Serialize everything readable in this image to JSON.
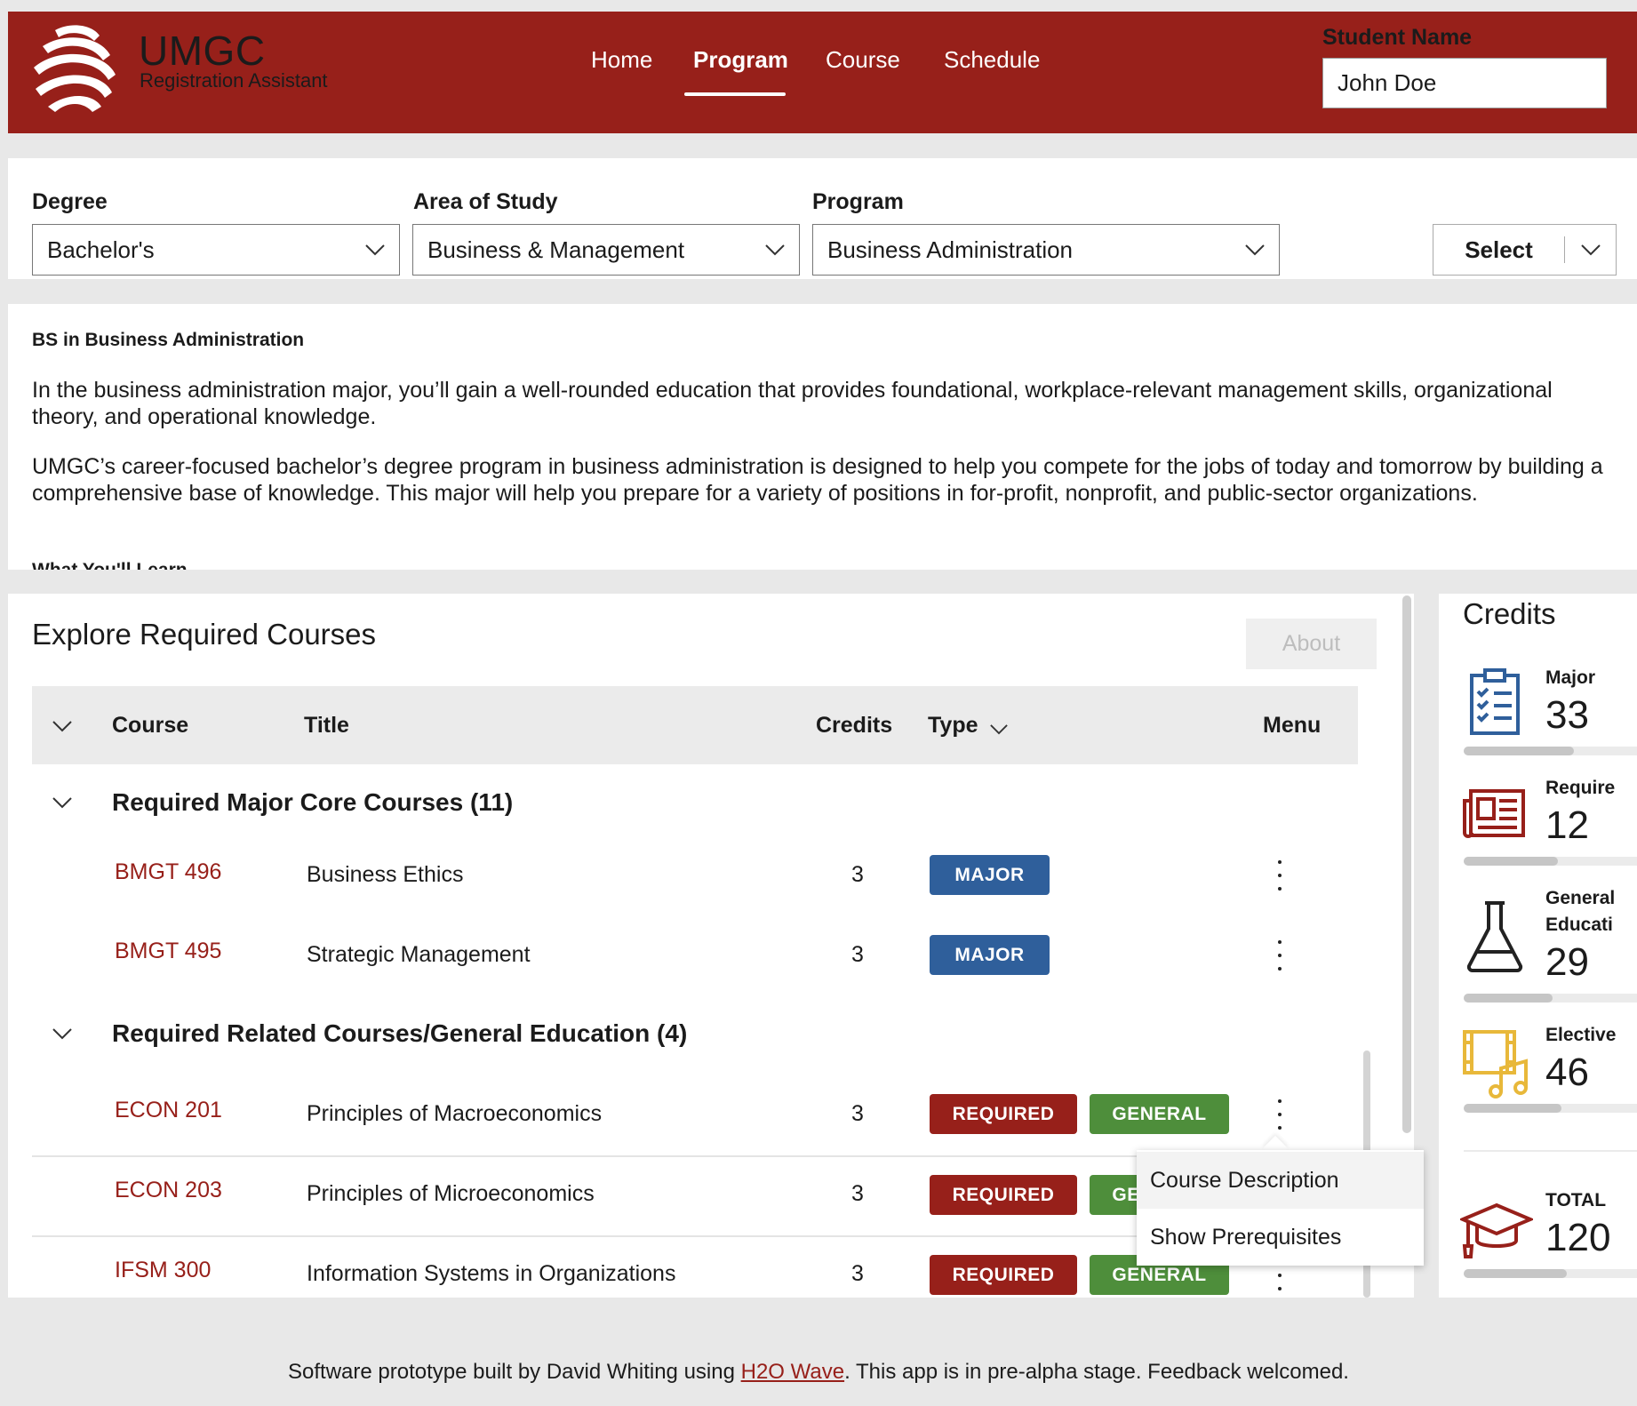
{
  "header": {
    "brand_title": "UMGC",
    "brand_subtitle": "Registration Assistant",
    "nav": [
      "Home",
      "Program",
      "Course",
      "Schedule"
    ],
    "active_nav": "Program",
    "student_label": "Student Name",
    "student_value": "John Doe",
    "color": "#97201a"
  },
  "selection": {
    "degree_label": "Degree",
    "degree_value": "Bachelor's",
    "area_label": "Area of Study",
    "area_value": "Business & Management",
    "program_label": "Program",
    "program_value": "Business Administration",
    "select_label": "Select"
  },
  "description": {
    "title": "BS in Business Administration",
    "p1": "In the business administration major, you’ll gain a well-rounded education that provides foundational, workplace-relevant management skills, organizational theory, and operational knowledge.",
    "p2": "UMGC’s career-focused bachelor’s degree program in business administration is designed to help you compete for the jobs of today and tomorrow by building a comprehensive base of knowledge. This major will help you prepare for a variety of positions in for-profit, nonprofit, and public-sector organizations.",
    "next_heading": "What You'll Learn"
  },
  "courses": {
    "title": "Explore Required Courses",
    "about_label": "About",
    "columns": {
      "course": "Course",
      "title": "Title",
      "credits": "Credits",
      "type": "Type",
      "menu": "Menu"
    },
    "groups": [
      {
        "label": "Required Major Core Courses (11)",
        "rows": [
          {
            "code": "BMGT 496",
            "title": "Business Ethics",
            "credits": "3",
            "badges": [
              "MAJOR"
            ]
          },
          {
            "code": "BMGT 495",
            "title": "Strategic Management",
            "credits": "3",
            "badges": [
              "MAJOR"
            ]
          }
        ]
      },
      {
        "label": "Required Related Courses/General Education (4)",
        "rows": [
          {
            "code": "ECON 201",
            "title": "Principles of Macroeconomics",
            "credits": "3",
            "badges": [
              "REQUIRED",
              "GENERAL"
            ]
          },
          {
            "code": "ECON 203",
            "title": "Principles of Microeconomics",
            "credits": "3",
            "badges": [
              "REQUIRED",
              "GENERAL"
            ]
          },
          {
            "code": "IFSM 300",
            "title": "Information Systems in Organizations",
            "credits": "3",
            "badges": [
              "REQUIRED",
              "GENERAL"
            ]
          }
        ]
      }
    ],
    "badge_colors": {
      "MAJOR": "#2f5f9b",
      "REQUIRED": "#97201a",
      "GENERAL": "#4e8e3b"
    }
  },
  "popup_menu": [
    "Course Description",
    "Show Prerequisites"
  ],
  "credits": {
    "title": "Credits",
    "items": [
      {
        "label": "Major",
        "value": "33",
        "icon": "clipboard-checklist-icon",
        "color": "#2f5f9b",
        "fill": 0.62
      },
      {
        "label": "Require",
        "value": "12",
        "icon": "newspaper-icon",
        "color": "#97201a",
        "fill": 0.53
      },
      {
        "label": "General Educati",
        "value": "29",
        "icon": "flask-icon",
        "color": "#222222",
        "fill": 0.5
      },
      {
        "label": "Elective",
        "value": "46",
        "icon": "media-music-icon",
        "color": "#e8b83a",
        "fill": 0.55
      },
      {
        "label": "TOTAL",
        "value": "120",
        "icon": "graduation-cap-icon",
        "color": "#97201a",
        "fill": 0.58
      }
    ]
  },
  "footer": {
    "before": "Software prototype built by David Whiting using ",
    "link": "H2O Wave",
    "after": ". This app is in pre-alpha stage. Feedback welcomed."
  }
}
